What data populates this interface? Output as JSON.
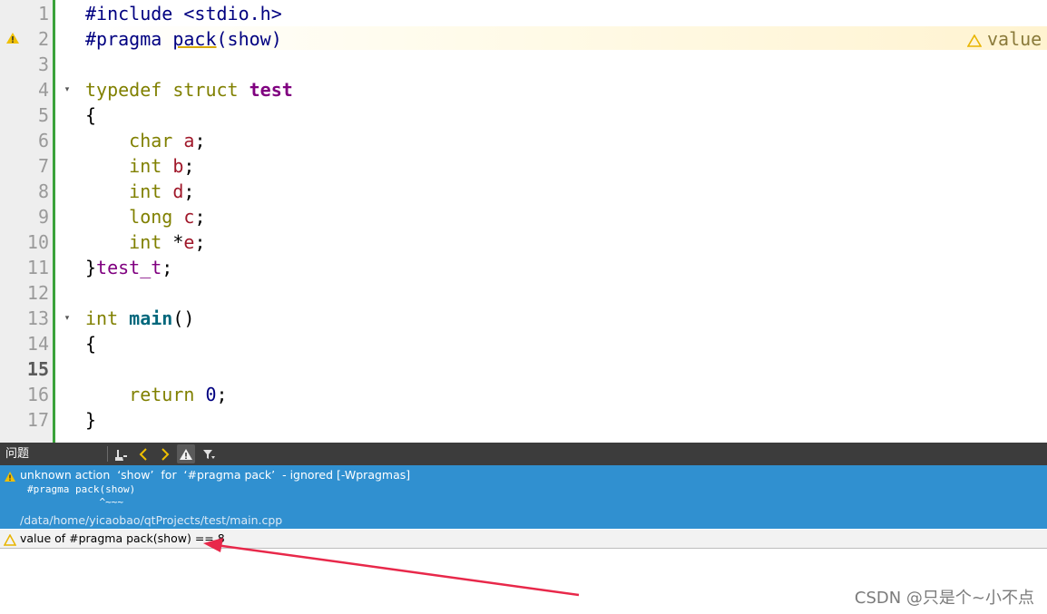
{
  "editor": {
    "current_line": "15",
    "lines": [
      {
        "num": "1",
        "tokens": [
          {
            "t": "#include <stdio.h>",
            "c": "pp"
          }
        ]
      },
      {
        "num": "2",
        "tokens": [
          {
            "t": "#pragma ",
            "c": "pp"
          },
          {
            "t": "pack",
            "c": "pp ul"
          },
          {
            "t": "(show)",
            "c": "pp"
          }
        ]
      },
      {
        "num": "3",
        "tokens": []
      },
      {
        "num": "4",
        "tokens": [
          {
            "t": "typedef ",
            "c": "kw-olive"
          },
          {
            "t": "struct ",
            "c": "kw-olive"
          },
          {
            "t": "test",
            "c": "kw-purple"
          }
        ]
      },
      {
        "num": "5",
        "tokens": [
          {
            "t": "{",
            "c": ""
          }
        ]
      },
      {
        "num": "6",
        "tokens": [
          {
            "t": "    ",
            "c": ""
          },
          {
            "t": "char ",
            "c": "kw-olive"
          },
          {
            "t": "a",
            "c": "var-red"
          },
          {
            "t": ";",
            "c": ""
          }
        ]
      },
      {
        "num": "7",
        "tokens": [
          {
            "t": "    ",
            "c": ""
          },
          {
            "t": "int ",
            "c": "kw-olive"
          },
          {
            "t": "b",
            "c": "var-red"
          },
          {
            "t": ";",
            "c": ""
          }
        ]
      },
      {
        "num": "8",
        "tokens": [
          {
            "t": "    ",
            "c": ""
          },
          {
            "t": "int ",
            "c": "kw-olive"
          },
          {
            "t": "d",
            "c": "var-red"
          },
          {
            "t": ";",
            "c": ""
          }
        ]
      },
      {
        "num": "9",
        "tokens": [
          {
            "t": "    ",
            "c": ""
          },
          {
            "t": "long ",
            "c": "kw-olive"
          },
          {
            "t": "c",
            "c": "var-red"
          },
          {
            "t": ";",
            "c": ""
          }
        ]
      },
      {
        "num": "10",
        "tokens": [
          {
            "t": "    ",
            "c": ""
          },
          {
            "t": "int ",
            "c": "kw-olive"
          },
          {
            "t": "*",
            "c": ""
          },
          {
            "t": "e",
            "c": "var-red"
          },
          {
            "t": ";",
            "c": ""
          }
        ]
      },
      {
        "num": "11",
        "tokens": [
          {
            "t": "}",
            "c": ""
          },
          {
            "t": "test_t",
            "c": "type-purple"
          },
          {
            "t": ";",
            "c": ""
          }
        ]
      },
      {
        "num": "12",
        "tokens": []
      },
      {
        "num": "13",
        "tokens": [
          {
            "t": "int ",
            "c": "kw-olive"
          },
          {
            "t": "main",
            "c": "fn-bold"
          },
          {
            "t": "()",
            "c": ""
          }
        ]
      },
      {
        "num": "14",
        "tokens": [
          {
            "t": "{",
            "c": ""
          }
        ]
      },
      {
        "num": "15",
        "tokens": []
      },
      {
        "num": "16",
        "tokens": [
          {
            "t": "    ",
            "c": ""
          },
          {
            "t": "return ",
            "c": "kw-olive"
          },
          {
            "t": "0",
            "c": "num"
          },
          {
            "t": ";",
            "c": ""
          }
        ]
      },
      {
        "num": "17",
        "tokens": [
          {
            "t": "}",
            "c": ""
          }
        ]
      }
    ],
    "fold_lines": [
      "4",
      "13"
    ],
    "warning_lines": [
      "2"
    ],
    "inline_warning_text": "value"
  },
  "issues": {
    "title": "问题",
    "selected": {
      "message": "unknown action  ‘show’  for  ‘#pragma pack’  - ignored [-Wpragmas]",
      "code_line": "#pragma pack(show)",
      "caret_line": "            ^~~~",
      "path": "/data/home/yicaobao/qtProjects/test/main.cpp"
    },
    "second": {
      "message": "value of #pragma pack(show) == 8"
    }
  },
  "colors": {
    "warning": "#e8b400",
    "selection": "#3090d0",
    "arrow": "#e8284a"
  },
  "watermark": "CSDN @只是个~小不点"
}
